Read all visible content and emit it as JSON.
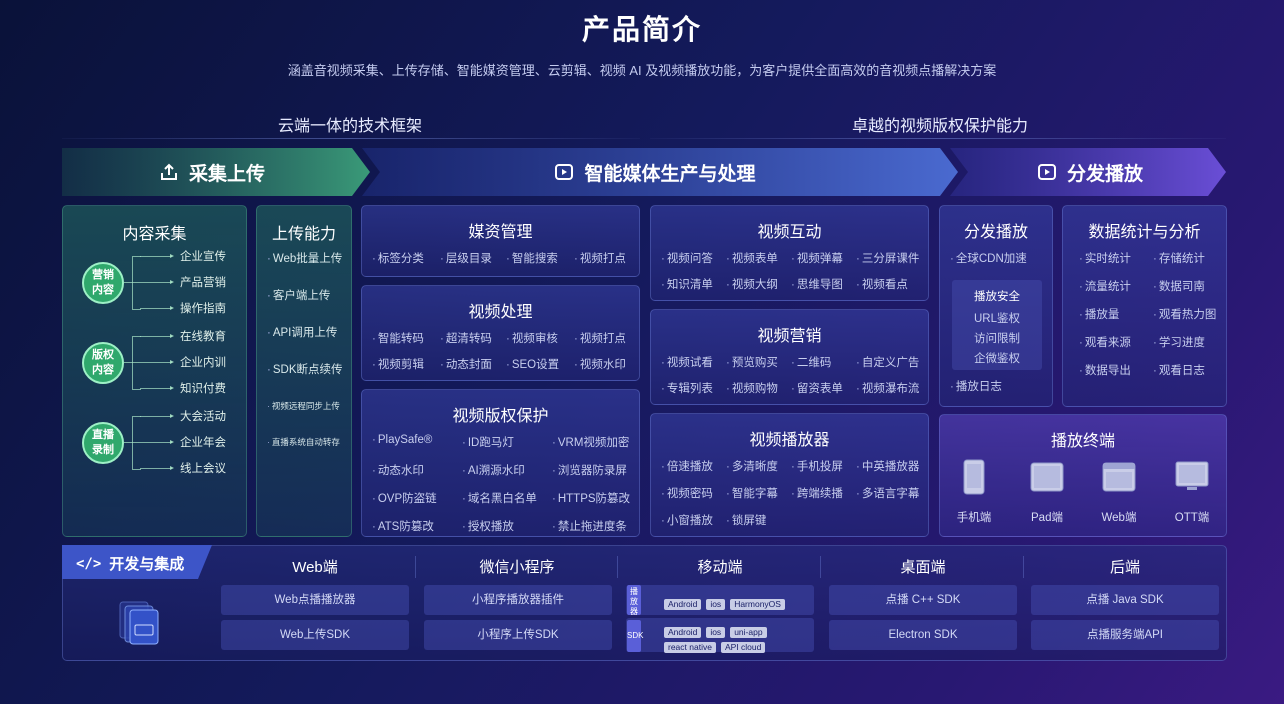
{
  "header": {
    "title": "产品简介",
    "subtitle": "涵盖音视频采集、上传存储、智能媒资管理、云剪辑、视频 AI 及视频播放功能，为客户提供全面高效的音视频点播解决方案"
  },
  "sections": {
    "left": "云端一体的技术框架",
    "right": "卓越的视频版权保护能力"
  },
  "stages": [
    {
      "label": "采集上传",
      "icon": "upload-icon"
    },
    {
      "label": "智能媒体生产与处理",
      "icon": "video-play-icon"
    },
    {
      "label": "分发播放",
      "icon": "video-play-icon"
    }
  ],
  "content_capture": {
    "title": "内容采集",
    "groups": [
      {
        "label": "营销内容",
        "items": [
          "企业宣传",
          "产品营销",
          "操作指南"
        ]
      },
      {
        "label": "版权内容",
        "items": [
          "在线教育",
          "企业内训",
          "知识付费"
        ]
      },
      {
        "label": "直播录制",
        "items": [
          "大会活动",
          "企业年会",
          "线上会议"
        ]
      }
    ]
  },
  "upload": {
    "title": "上传能力",
    "items": [
      "Web批量上传",
      "客户端上传",
      "API调用上传",
      "SDK断点续传",
      "视频远程同步上传",
      "直播系统自动转存"
    ]
  },
  "media_mgmt": {
    "title": "媒资管理",
    "items": [
      "标签分类",
      "层级目录",
      "智能搜索",
      "视频打点"
    ]
  },
  "video_proc": {
    "title": "视频处理",
    "items": [
      "智能转码",
      "超清转码",
      "视频审核",
      "视频打点",
      "视频剪辑",
      "动态封面",
      "SEO设置",
      "视频水印"
    ]
  },
  "copyright": {
    "title": "视频版权保护",
    "items": [
      "PlaySafe®",
      "ID跑马灯",
      "VRM视频加密",
      "动态水印",
      "AI溯源水印",
      "浏览器防录屏",
      "OVP防盗链",
      "域名黑白名单",
      "HTTPS防篡改",
      "ATS防篡改",
      "授权播放",
      "禁止拖进度条"
    ]
  },
  "interaction": {
    "title": "视频互动",
    "items": [
      "视频问答",
      "视频表单",
      "视频弹幕",
      "三分屏课件",
      "知识清单",
      "视频大纲",
      "思维导图",
      "视频看点"
    ]
  },
  "marketing": {
    "title": "视频营销",
    "items": [
      "视频试看",
      "预览购买",
      "二维码",
      "自定义广告",
      "专辑列表",
      "视频购物",
      "留资表单",
      "视频瀑布流"
    ]
  },
  "player": {
    "title": "视频播放器",
    "items": [
      "倍速播放",
      "多清晰度",
      "手机投屏",
      "中英播放器",
      "视频密码",
      "智能字幕",
      "跨端续播",
      "多语言字幕",
      "小窗播放",
      "锁屏键"
    ]
  },
  "distribution": {
    "title": "分发播放",
    "cdn": "全球CDN加速",
    "security": {
      "title": "播放安全",
      "items": [
        "URL鉴权",
        "访问限制",
        "企微鉴权"
      ]
    },
    "log": "播放日志"
  },
  "stats": {
    "title": "数据统计与分析",
    "items": [
      "实时统计",
      "存储统计",
      "流量统计",
      "数据司南",
      "播放量",
      "观看热力图",
      "观看来源",
      "学习进度",
      "数据导出",
      "观看日志"
    ]
  },
  "terminals": {
    "title": "播放终端",
    "items": [
      {
        "label": "手机端",
        "icon": "phone-icon"
      },
      {
        "label": "Pad端",
        "icon": "tablet-icon"
      },
      {
        "label": "Web端",
        "icon": "browser-icon"
      },
      {
        "label": "OTT端",
        "icon": "tv-icon"
      }
    ]
  },
  "dev": {
    "title": "开发与集成",
    "columns": [
      {
        "title": "Web端",
        "boxes": [
          "Web点播播放器",
          "Web上传SDK"
        ]
      },
      {
        "title": "微信小程序",
        "boxes": [
          "小程序播放器插件",
          "小程序上传SDK"
        ]
      },
      {
        "title": "移动端",
        "player_badge": "播放器",
        "player_tags": [
          "Android",
          "ios",
          "HarmonyOS"
        ],
        "sdk_badge": "SDK",
        "sdk_tags": [
          "Android",
          "ios",
          "uni-app",
          "react native",
          "API cloud"
        ]
      },
      {
        "title": "桌面端",
        "boxes": [
          "点播 C++ SDK",
          "Electron SDK"
        ]
      },
      {
        "title": "后端",
        "boxes": [
          "点播 Java SDK",
          "点播服务端API"
        ]
      }
    ]
  },
  "colors": {
    "green_stage": "#3a9a78",
    "blue_stage": "#4a62c8",
    "purple_stage": "#5a4cc8",
    "circle": "#2fa86c"
  }
}
